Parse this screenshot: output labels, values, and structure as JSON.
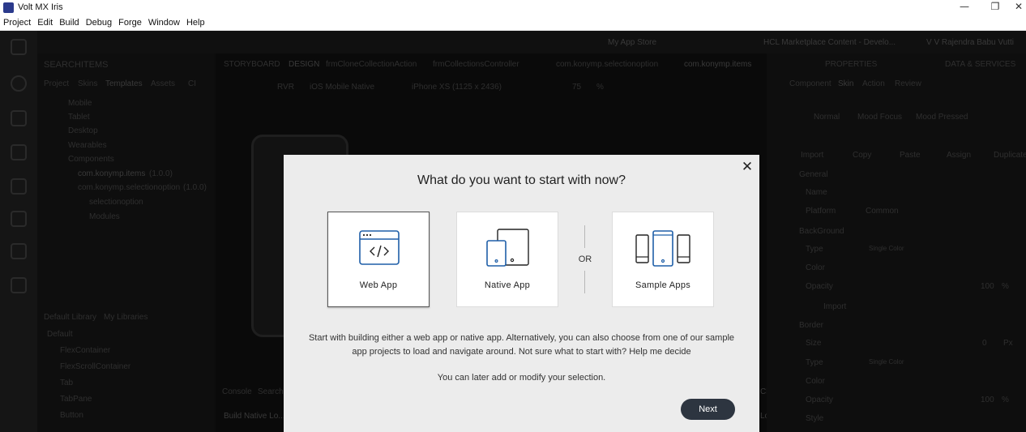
{
  "window": {
    "title": "Volt MX Iris",
    "minimize_glyph": "—",
    "restore_glyph": "❐",
    "close_glyph": "✕"
  },
  "menu": [
    "Project",
    "Edit",
    "Build",
    "Debug",
    "Forge",
    "Window",
    "Help"
  ],
  "background": {
    "topbar": {
      "app_store": "My App Store",
      "marketplace": "HCL Marketplace Content - Develo...",
      "user": "V V Rajendra Babu Vutti"
    },
    "editor_tabs": [
      "STORYBOARD",
      "DESIGN",
      "frmCloneCollectionAction",
      "frmCollectionsController",
      "com.konymp.selectionoption",
      "com.konymp.items"
    ],
    "right_tabs": [
      "PROPERTIES",
      "DATA & SERVICES"
    ],
    "left_header": "SEARCHITEMS",
    "left_tabs": [
      "Project",
      "Skins",
      "Templates",
      "Assets",
      "CI"
    ],
    "tree": [
      "Mobile",
      "Tablet",
      "Desktop",
      "Wearables",
      "Components",
      "com.konymp.items",
      "(1.0.0)",
      "com.konymp.selectionoption",
      "(1.0.0)",
      "selectionoption",
      "Modules"
    ],
    "toolbar": [
      "RVR",
      "iOS Mobile  Native",
      "iPhone XS (1125 x 2436)",
      "75",
      "%"
    ],
    "prop_tabs": [
      "Component",
      "Skin",
      "Action",
      "Review"
    ],
    "prop_states": [
      "Normal",
      "Mood Focus",
      "Mood Pressed"
    ],
    "prop_actions": [
      "Import",
      "Copy",
      "Paste",
      "Assign",
      "Duplicate"
    ],
    "prop_sections": [
      "General",
      "Name",
      "Platform",
      "Common",
      "BackGround",
      "Type",
      "Single Color",
      "Color",
      "Opacity",
      "100",
      "%",
      "Import",
      "Border",
      "Size",
      "0",
      "Px",
      "Type",
      "Single Color",
      "Color",
      "Opacity",
      "100",
      "%",
      "Style"
    ],
    "library": {
      "tabs": [
        "Default Library",
        "My Libraries"
      ],
      "group": "Default",
      "items": [
        "FlexContainer",
        "FlexScrollContainer",
        "Tab",
        "TabPane",
        "Button"
      ]
    },
    "console": [
      "Console",
      "Search",
      "Build Native Lo...",
      "Clear",
      "Logs"
    ]
  },
  "dialog": {
    "title": "What do you want to start with now?",
    "options": [
      {
        "label": "Web App",
        "icon": "web-app-icon",
        "selected": true
      },
      {
        "label": "Native App",
        "icon": "native-app-icon",
        "selected": false
      },
      {
        "label": "Sample Apps",
        "icon": "sample-apps-icon",
        "selected": false
      }
    ],
    "or_text": "OR",
    "description": "Start with building either a web app or native app. Alternatively, you can also choose from one of our sample app projects to load and navigate around. Not sure what to start with? Help me decide",
    "note": "You can later add or modify your selection.",
    "next_label": "Next",
    "close_glyph": "✕"
  },
  "colors": {
    "icon_blue": "#1f5fa8",
    "next_button": "#2d3540",
    "dialog_bg": "#ececec"
  }
}
